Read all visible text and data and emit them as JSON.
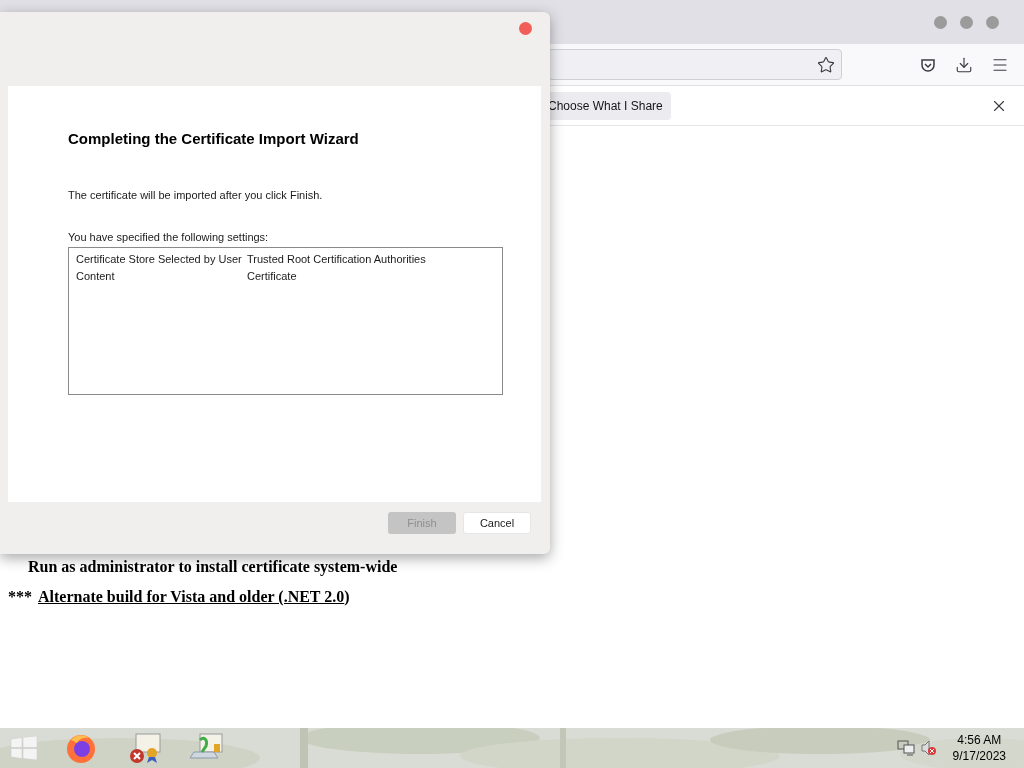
{
  "browser": {
    "notification": {
      "button": "Choose What I Share"
    }
  },
  "page": {
    "lines": [
      {
        "kind": "text",
        "text": "Run as administrator to install certificate system-wide"
      },
      {
        "kind": "link",
        "prefix": "***",
        "link": "Alternate build for Vista and older (.NET 2.0",
        "suffix": ")"
      }
    ]
  },
  "dialog": {
    "heading": "Completing the Certificate Import Wizard",
    "message": "The certificate will be imported after you click Finish.",
    "settings_label": "You have specified the following settings:",
    "settings": [
      {
        "name": "Certificate Store Selected by User",
        "value": "Trusted Root Certification Authorities"
      },
      {
        "name": "Content",
        "value": "Certificate"
      }
    ],
    "buttons": [
      {
        "label": "Finish",
        "disabled": true
      },
      {
        "label": "Cancel",
        "disabled": false
      }
    ]
  },
  "taskbar": {
    "time": "4:56 AM",
    "date": "9/17/2023"
  }
}
